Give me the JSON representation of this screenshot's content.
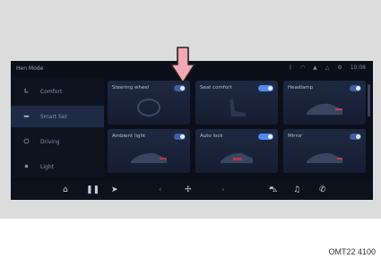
{
  "status_bar": {
    "home_label": "Hen Mode",
    "time": "10:08"
  },
  "sidebar": {
    "items": [
      {
        "label": "Comfort",
        "icon": "seat-icon"
      },
      {
        "label": "Smart Set",
        "icon": "car-icon"
      },
      {
        "label": "Driving",
        "icon": "steering-icon"
      },
      {
        "label": "Light",
        "icon": "light-icon"
      }
    ]
  },
  "cards": [
    {
      "title": "Steering wheel",
      "toggle": "on"
    },
    {
      "title": "Seat comfort",
      "toggle": "on"
    },
    {
      "title": "Headlamp",
      "toggle": "off"
    },
    {
      "title": "Ambient light",
      "toggle": "off"
    },
    {
      "title": "Auto lock",
      "toggle": "on"
    },
    {
      "title": "Mirror",
      "toggle": "off"
    }
  ],
  "figure_code": "OMT22 4100",
  "colors": {
    "accent": "#4f8bf0",
    "screen_bg": "#0b0f1a",
    "arrow": "#f2a7b5"
  }
}
